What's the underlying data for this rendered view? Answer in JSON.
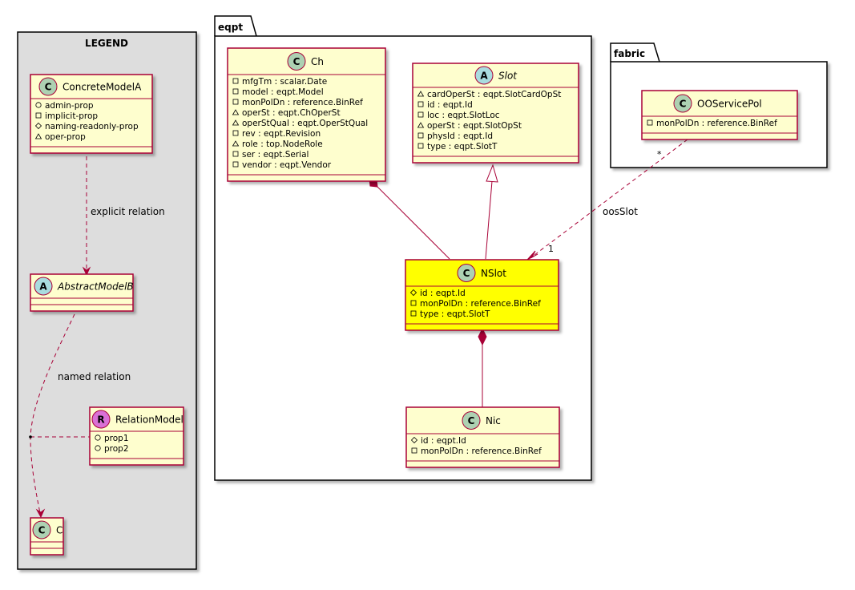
{
  "colors": {
    "class_fill": "#FEFECE",
    "class_border": "#A80036",
    "highlight_fill": "#FFFF00",
    "legend_fill": "#DDDDDD",
    "circle_class": "#ADD1B2",
    "circle_abstract": "#A9DCDF",
    "circle_relation": "#DA70D6",
    "edge": "#A80036"
  },
  "legend": {
    "title": "LEGEND",
    "concrete": {
      "name": "ConcreteModelA",
      "stereotype": "C",
      "attrs": [
        {
          "vis": "+",
          "text": "admin-prop"
        },
        {
          "vis": "-",
          "text": "implicit-prop"
        },
        {
          "vis": "#",
          "text": "naming-readonly-prop"
        },
        {
          "vis": "~",
          "text": "oper-prop"
        }
      ]
    },
    "abstract": {
      "name": "AbstractModelB",
      "stereotype": "A"
    },
    "relation_model": {
      "name": "RelationModel",
      "stereotype": "R",
      "attrs": [
        {
          "vis": "+",
          "text": "prop1"
        },
        {
          "vis": "+",
          "text": "prop2"
        }
      ]
    },
    "c": {
      "name": "C",
      "stereotype": "C"
    },
    "explicit_label": "explicit relation",
    "named_label": "named relation"
  },
  "eqpt": {
    "title": "eqpt",
    "ch": {
      "name": "Ch",
      "stereotype": "C",
      "attrs": [
        {
          "vis": "-",
          "text": "mfgTm : scalar.Date"
        },
        {
          "vis": "-",
          "text": "model : eqpt.Model"
        },
        {
          "vis": "-",
          "text": "monPolDn : reference.BinRef"
        },
        {
          "vis": "~",
          "text": "operSt : eqpt.ChOperSt"
        },
        {
          "vis": "~",
          "text": "operStQual : eqpt.OperStQual"
        },
        {
          "vis": "-",
          "text": "rev : eqpt.Revision"
        },
        {
          "vis": "~",
          "text": "role : top.NodeRole"
        },
        {
          "vis": "-",
          "text": "ser : eqpt.Serial"
        },
        {
          "vis": "-",
          "text": "vendor : eqpt.Vendor"
        }
      ]
    },
    "slot": {
      "name": "Slot",
      "stereotype": "A",
      "attrs": [
        {
          "vis": "~",
          "text": "cardOperSt : eqpt.SlotCardOpSt"
        },
        {
          "vis": "-",
          "text": "id : eqpt.Id"
        },
        {
          "vis": "-",
          "text": "loc : eqpt.SlotLoc"
        },
        {
          "vis": "~",
          "text": "operSt : eqpt.SlotOpSt"
        },
        {
          "vis": "-",
          "text": "physId : eqpt.Id"
        },
        {
          "vis": "-",
          "text": "type : eqpt.SlotT"
        }
      ]
    },
    "nslot": {
      "name": "NSlot",
      "stereotype": "C",
      "attrs": [
        {
          "vis": "#",
          "text": "id : eqpt.Id"
        },
        {
          "vis": "-",
          "text": "monPolDn : reference.BinRef"
        },
        {
          "vis": "-",
          "text": "type : eqpt.SlotT"
        }
      ]
    },
    "nic": {
      "name": "Nic",
      "stereotype": "C",
      "attrs": [
        {
          "vis": "#",
          "text": "id : eqpt.Id"
        },
        {
          "vis": "-",
          "text": "monPolDn : reference.BinRef"
        }
      ]
    }
  },
  "fabric": {
    "title": "fabric",
    "ooservicepol": {
      "name": "OOServicePol",
      "stereotype": "C",
      "attrs": [
        {
          "vis": "-",
          "text": "monPolDn : reference.BinRef"
        }
      ]
    }
  },
  "oos_relation": {
    "label": "oosSlot",
    "src_mult": "*",
    "dst_mult": "1"
  }
}
